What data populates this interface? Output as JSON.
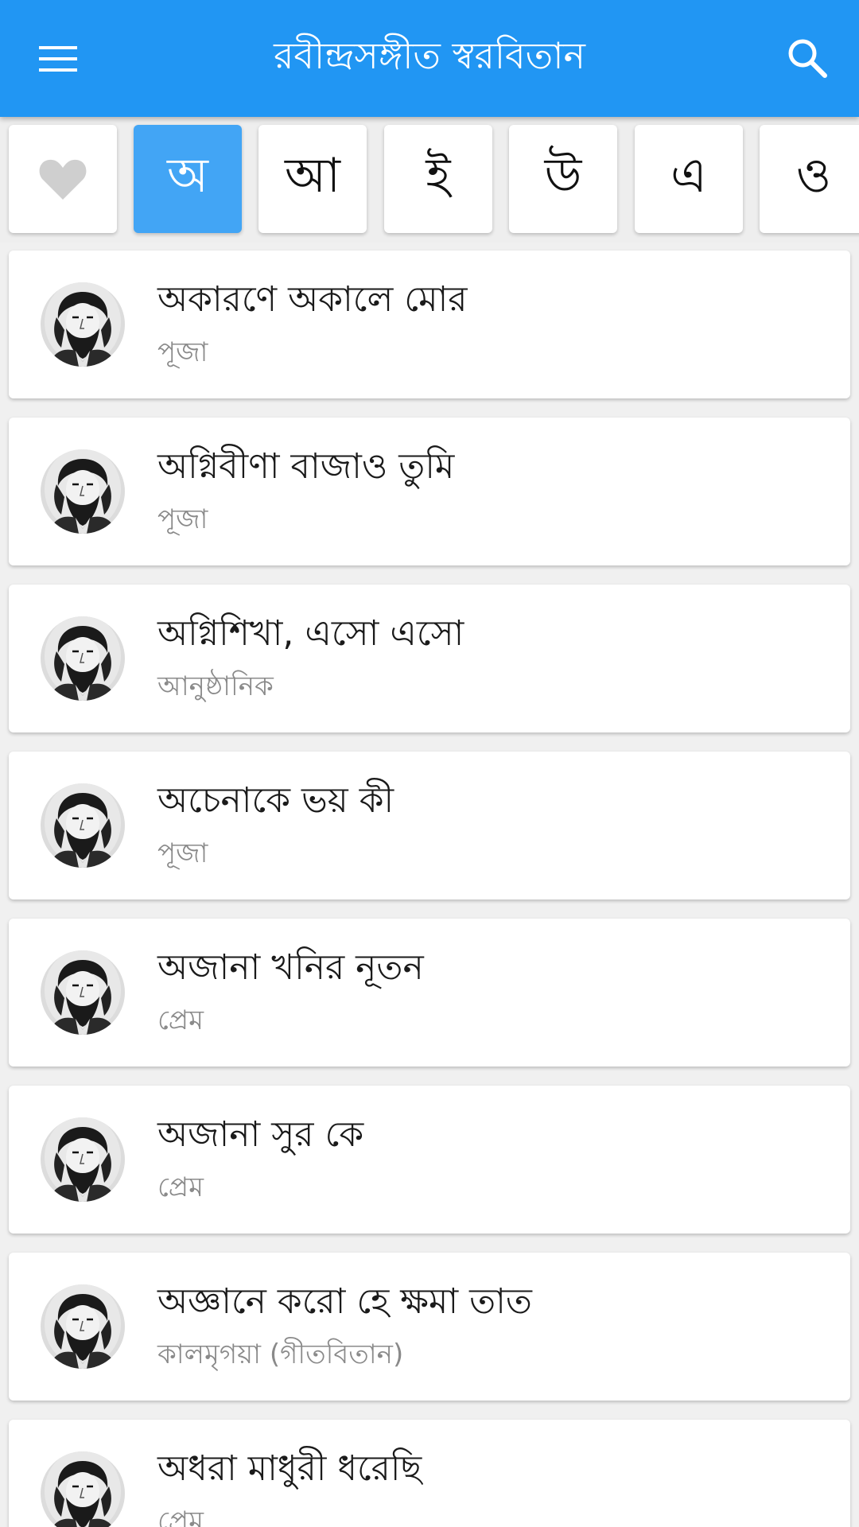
{
  "app_bar": {
    "title": "রবীন্দ্রসঙ্গীত স্বরবিতান",
    "menu_icon": "hamburger-menu-icon",
    "search_icon": "search-icon",
    "background": "#2196f3"
  },
  "letter_tabs": {
    "favorites_icon": "heart-icon",
    "letters": [
      "অ",
      "আ",
      "ই",
      "উ",
      "এ",
      "ও"
    ],
    "selected": "অ",
    "active_color": "#42a5f5"
  },
  "songs": [
    {
      "title": "অকারণে অকালে মোর",
      "category": "পূজা"
    },
    {
      "title": "অগ্নিবীণা বাজাও তুমি",
      "category": "পূজা"
    },
    {
      "title": "অগ্নিশিখা, এসো এসো",
      "category": "আনুষ্ঠানিক"
    },
    {
      "title": "অচেনাকে ভয় কী",
      "category": "পূজা"
    },
    {
      "title": "অজানা খনির নূতন",
      "category": "প্রেম"
    },
    {
      "title": "অজানা সুর কে",
      "category": "প্রেম"
    },
    {
      "title": "অজ্ঞানে করো হে ক্ষমা তাত",
      "category": "কালমৃগয়া (গীতবিতান)"
    },
    {
      "title": "অধরা মাধুরী ধরেছি",
      "category": "প্রেম"
    }
  ]
}
